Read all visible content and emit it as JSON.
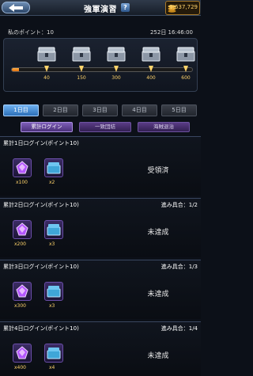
{
  "header": {
    "title": "強軍演習",
    "help_label": "?",
    "currency": "1,637,729"
  },
  "info": {
    "points_label": "私のポイント：10",
    "time": "252日 16:46:00"
  },
  "reward_track": {
    "progress_fraction": 0.04,
    "milestones": [
      "40",
      "150",
      "300",
      "400",
      "600"
    ],
    "colors": {
      "fill": "#f0952a",
      "accent": "#ffd36a"
    }
  },
  "day_tabs": [
    "1日目",
    "2日目",
    "3日目",
    "4日目",
    "5日目"
  ],
  "sub_tabs": [
    "累計ログイン",
    "一致団結",
    "海賊退治"
  ],
  "missions": [
    {
      "title": "累計1日ログイン(ポイント10)",
      "progress": "",
      "items": [
        {
          "qty": "x100"
        },
        {
          "qty": "x2"
        }
      ],
      "status": "受領済"
    },
    {
      "title": "累計2日ログイン(ポイント10)",
      "progress": "進み具合：1/2",
      "items": [
        {
          "qty": "x200"
        },
        {
          "qty": "x3"
        }
      ],
      "status": "未達成"
    },
    {
      "title": "累計3日ログイン(ポイント10)",
      "progress": "進み具合：1/3",
      "items": [
        {
          "qty": "x300"
        },
        {
          "qty": "x3"
        }
      ],
      "status": "未達成"
    },
    {
      "title": "累計4日ログイン(ポイント10)",
      "progress": "進み具合：1/4",
      "items": [
        {
          "qty": "x400"
        },
        {
          "qty": "x4"
        }
      ],
      "status": "未達成"
    }
  ]
}
